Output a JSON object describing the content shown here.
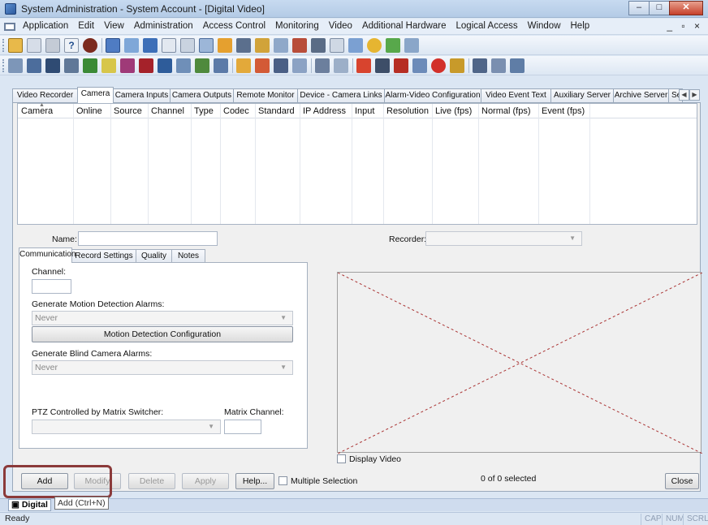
{
  "window": {
    "title": "System Administration - System Account - [Digital Video]",
    "controls": {
      "minimize": "–",
      "maximize": "□",
      "close": "✕"
    }
  },
  "menubar": {
    "items": [
      "Application",
      "Edit",
      "View",
      "Administration",
      "Access Control",
      "Monitoring",
      "Video",
      "Additional Hardware",
      "Logical Access",
      "Window",
      "Help"
    ],
    "mdi_controls": "_ ▫ ×"
  },
  "tabs": {
    "items": [
      "Video Recorder",
      "Camera",
      "Camera Inputs",
      "Camera Outputs",
      "Remote Monitor",
      "Device - Camera Links",
      "Alarm-Video Configuration",
      "Video Event Text",
      "Auxiliary Server",
      "Archive Server",
      "Se"
    ],
    "active": "Camera"
  },
  "grid": {
    "columns": [
      "Camera",
      "Online",
      "Source",
      "Channel",
      "Type",
      "Codec",
      "Standard",
      "IP Address",
      "Input",
      "Resolution",
      "Live (fps)",
      "Normal (fps)",
      "Event (fps)"
    ],
    "rows": []
  },
  "form": {
    "name_label": "Name:",
    "name_value": "",
    "recorder_label": "Recorder:",
    "recorder_value": "",
    "inner_tabs": [
      "Communication",
      "Record Settings",
      "Quality",
      "Notes"
    ],
    "channel_label": "Channel:",
    "channel_value": "",
    "motion_alarms_label": "Generate Motion Detection Alarms:",
    "motion_alarms_value": "Never",
    "motion_config_button": "Motion Detection Configuration",
    "blind_alarms_label": "Generate Blind Camera Alarms:",
    "blind_alarms_value": "Never",
    "ptz_label": "PTZ Controlled by Matrix Switcher:",
    "ptz_value": "",
    "matrix_channel_label": "Matrix Channel:",
    "matrix_channel_value": "",
    "display_video_label": "Display Video"
  },
  "buttons": {
    "add": "Add",
    "modify": "Modify",
    "delete": "Delete",
    "apply": "Apply",
    "help": "Help...",
    "multiple_selection": "Multiple Selection",
    "selection_count": "0 of 0 selected",
    "close": "Close"
  },
  "taskbar": {
    "tab_label": "Digital",
    "tooltip": "Add (Ctrl+N)"
  },
  "status": {
    "text": "Ready",
    "indicators": [
      "CAP",
      "NUM",
      "SCRL"
    ]
  }
}
